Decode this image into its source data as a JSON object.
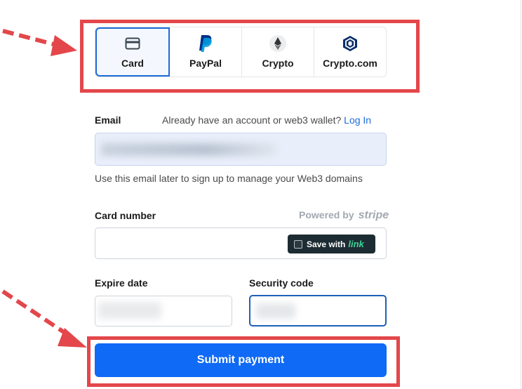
{
  "payment_methods": [
    {
      "label": "Card",
      "icon": "card-icon",
      "active": true
    },
    {
      "label": "PayPal",
      "icon": "paypal-icon",
      "active": false
    },
    {
      "label": "Crypto",
      "icon": "ethereum-icon",
      "active": false
    },
    {
      "label": "Crypto.com",
      "icon": "crypto-com-icon",
      "active": false
    }
  ],
  "email": {
    "label": "Email",
    "account_prompt": "Already have an account or web3 wallet?",
    "login_link": "Log In",
    "hint": "Use this email later to sign up to manage your Web3 domains"
  },
  "card": {
    "label": "Card number",
    "powered_by": "Powered by",
    "powered_brand": "stripe",
    "save_with": "Save with",
    "link_brand": "link"
  },
  "expire": {
    "label": "Expire date"
  },
  "security": {
    "label": "Security code"
  },
  "submit": {
    "label": "Submit payment"
  },
  "colors": {
    "accent": "#0f6af5",
    "annotation_red": "#e3474b",
    "active_tab_border": "#1e6bd6"
  }
}
